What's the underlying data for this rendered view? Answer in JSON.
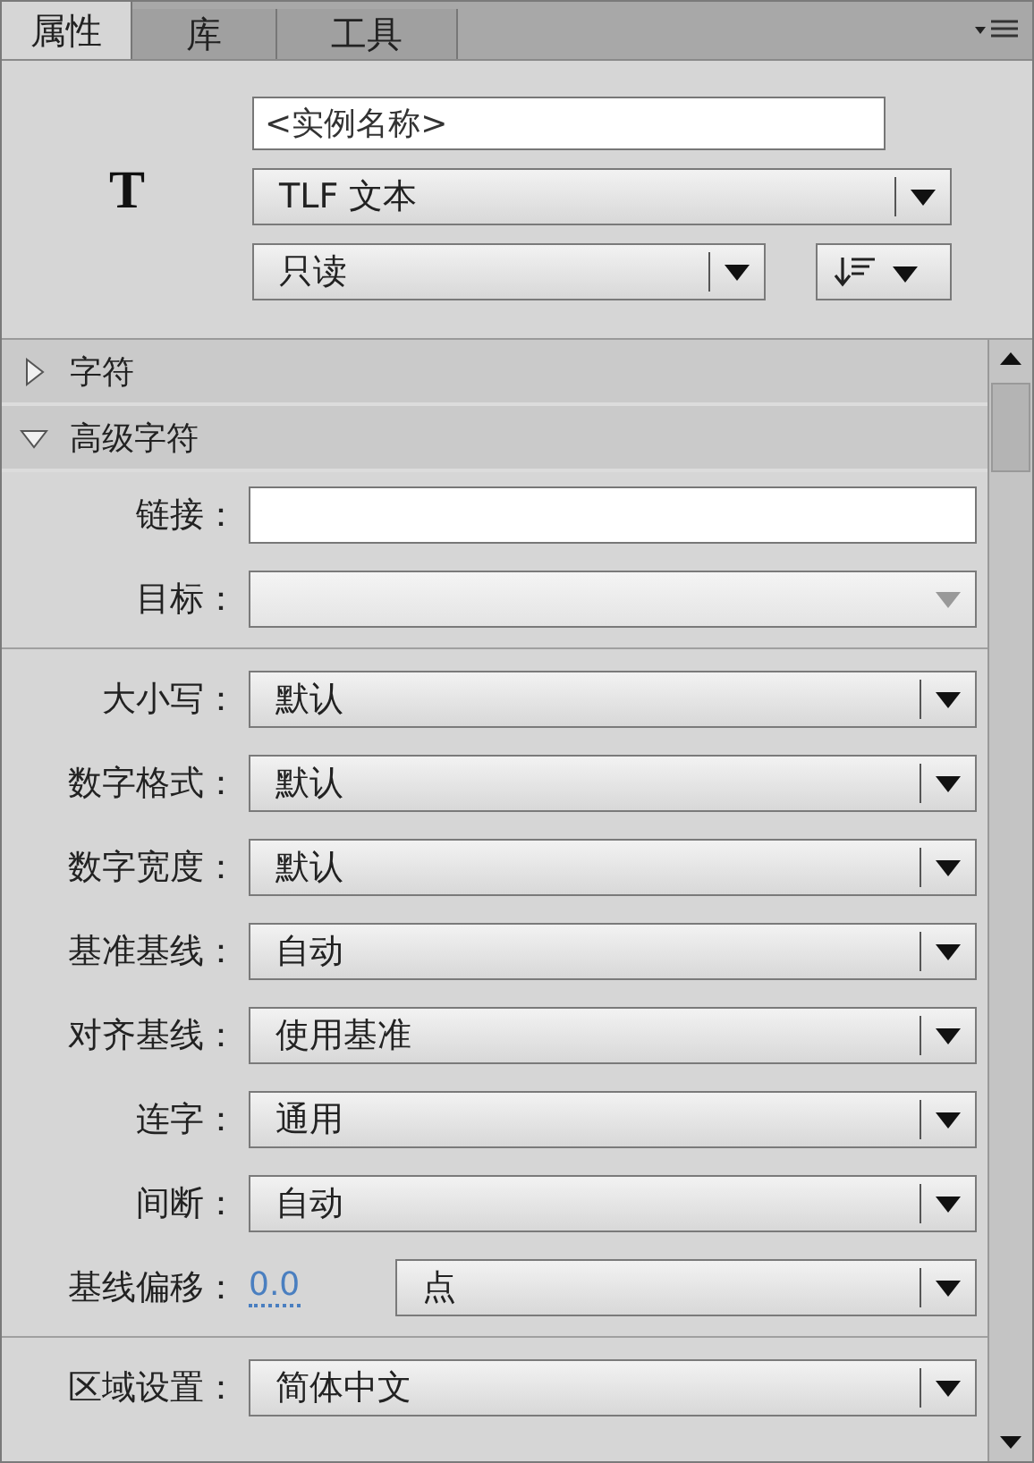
{
  "tabs": [
    {
      "label": "属性",
      "selected": true
    },
    {
      "label": "库",
      "selected": false
    },
    {
      "label": "工具",
      "selected": false
    }
  ],
  "header": {
    "symbol": "T",
    "instance_name": {
      "placeholder": "<实例名称>"
    },
    "text_type": "TLF 文本",
    "behavior": "只读"
  },
  "sections": [
    {
      "title": "字符",
      "expanded": false
    },
    {
      "title": "高级字符",
      "expanded": true
    }
  ],
  "link": {
    "label": "链接："
  },
  "target": {
    "label": "目标：",
    "disabled": true
  },
  "properties": [
    {
      "kind": "dropdown",
      "label": "大小写：",
      "value": "默认"
    },
    {
      "kind": "dropdown",
      "label": "数字格式：",
      "value": "默认"
    },
    {
      "kind": "dropdown",
      "label": "数字宽度：",
      "value": "默认"
    },
    {
      "kind": "dropdown",
      "label": "基准基线：",
      "value": "自动"
    },
    {
      "kind": "dropdown",
      "label": "对齐基线：",
      "value": "使用基准"
    },
    {
      "kind": "dropdown",
      "label": "连字：",
      "value": "通用"
    },
    {
      "kind": "dropdown",
      "label": "间断：",
      "value": "自动"
    },
    {
      "kind": "offset",
      "label": "基线偏移：",
      "number": "0.0",
      "value": "点"
    }
  ],
  "locale": {
    "label": "区域设置：",
    "value": "简体中文"
  }
}
